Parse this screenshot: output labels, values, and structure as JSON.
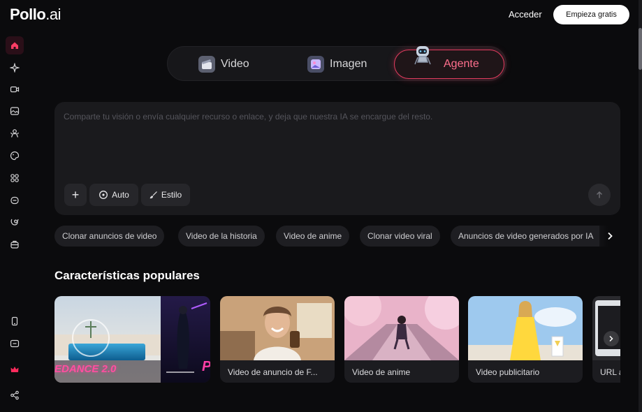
{
  "header": {
    "logo_main": "Pollo",
    "logo_suffix": ".ai",
    "login_label": "Acceder",
    "signup_label": "Empieza gratis"
  },
  "sidebar": {
    "items": [
      {
        "icon": "home-icon",
        "active": true
      },
      {
        "icon": "sparkle-icon"
      },
      {
        "icon": "video-camera-icon"
      },
      {
        "icon": "image-icon"
      },
      {
        "icon": "character-icon"
      },
      {
        "icon": "palette-icon"
      },
      {
        "icon": "apps-icon"
      },
      {
        "icon": "face-icon"
      },
      {
        "icon": "translate-icon"
      },
      {
        "icon": "package-icon"
      }
    ],
    "bottom_items": [
      {
        "icon": "mobile-icon"
      },
      {
        "icon": "chat-icon"
      },
      {
        "icon": "crown-icon"
      },
      {
        "icon": "share-icon"
      }
    ]
  },
  "modes": {
    "video_label": "Video",
    "image_label": "Imagen",
    "agent_label": "Agente",
    "active": "Agente"
  },
  "prompt": {
    "placeholder": "Comparte tu visión o envía cualquier recurso o enlace, y deja que nuestra IA se encargue del resto.",
    "add_label": "+",
    "auto_label": "Auto",
    "style_label": "Estilo"
  },
  "chips": [
    "Clonar anuncios de video",
    "Video de la historia",
    "Video de anime",
    "Clonar video viral",
    "Anuncios de video generados por IA"
  ],
  "popular": {
    "title": "Características populares",
    "hero_text": "EDANCE 2.0",
    "hero_text_2": "P",
    "cards": [
      "Video de anuncio de F...",
      "Video de anime",
      "Video publicitario",
      "URL a..."
    ]
  },
  "colors": {
    "accent": "#e23c5f",
    "background": "#0b0b0d",
    "panel": "#1a1a1d"
  }
}
